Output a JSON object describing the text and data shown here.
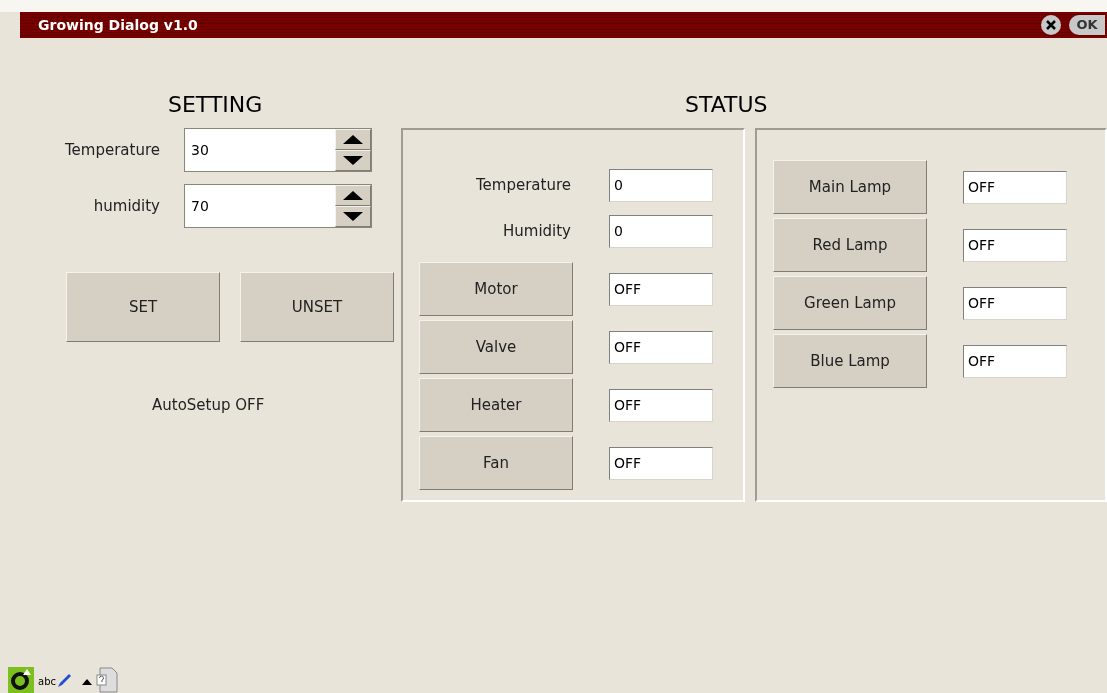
{
  "window": {
    "title": "Growing Dialog v1.0",
    "ok_button": "OK"
  },
  "setting": {
    "heading": "SETTING",
    "fields": [
      {
        "label": "Temperature",
        "value": "30"
      },
      {
        "label": "humidity",
        "value": "70"
      }
    ],
    "buttons": [
      "SET",
      "UNSET"
    ],
    "auto_setup": "AutoSetup OFF"
  },
  "status": {
    "heading": "STATUS",
    "readings": [
      {
        "label": "Temperature",
        "value": "0"
      },
      {
        "label": "Humidity",
        "value": "0"
      }
    ],
    "devices": [
      {
        "label": "Motor",
        "value": "OFF"
      },
      {
        "label": "Valve",
        "value": "OFF"
      },
      {
        "label": "Heater",
        "value": "OFF"
      },
      {
        "label": "Fan",
        "value": "OFF"
      }
    ],
    "lamps": [
      {
        "label": "Main Lamp",
        "value": "OFF"
      },
      {
        "label": "Red Lamp",
        "value": "OFF"
      },
      {
        "label": "Green Lamp",
        "value": "OFF"
      },
      {
        "label": "Blue Lamp",
        "value": "OFF"
      }
    ]
  },
  "taskbar": {
    "abc_label": "abc"
  }
}
